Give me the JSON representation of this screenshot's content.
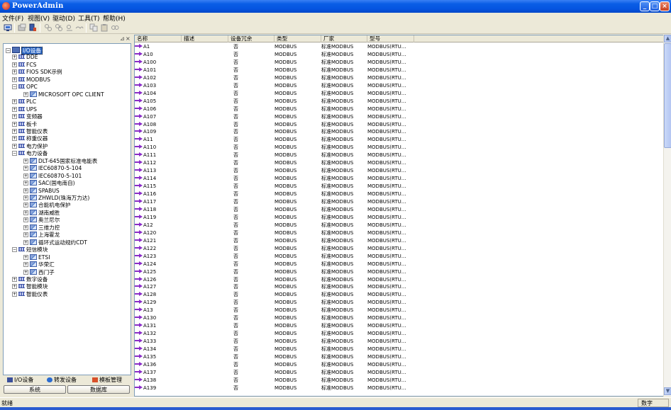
{
  "window": {
    "title": "PowerAdmin"
  },
  "menu": [
    "文件(F)",
    "视图(V)",
    "驱动(D)",
    "工具(T)",
    "帮助(H)"
  ],
  "toolbar": {
    "icons": [
      "monitor-icon",
      "folder-add-icon",
      "device-add-icon",
      "tag-add-icon",
      "tag-copy-icon",
      "tag-paste-icon",
      "tag-link-icon",
      "copy-icon",
      "paste-icon",
      "find-icon"
    ]
  },
  "left_panel": {
    "pin_glyph": "⊿",
    "close_glyph": "×",
    "tree": [
      {
        "label": "I/O设备",
        "level": 0,
        "type": "root",
        "expand": "−",
        "selected": true
      },
      {
        "label": "DDE",
        "level": 1,
        "type": "folder",
        "expand": "+"
      },
      {
        "label": "FCS",
        "level": 1,
        "type": "folder",
        "expand": "+"
      },
      {
        "label": "FIOS SDK示例",
        "level": 1,
        "type": "folder",
        "expand": "+"
      },
      {
        "label": "MODBUS",
        "level": 1,
        "type": "folder",
        "expand": "+"
      },
      {
        "label": "OPC",
        "level": 1,
        "type": "folder",
        "expand": "−"
      },
      {
        "label": "MICROSOFT OPC CLIENT",
        "level": 2,
        "type": "device",
        "expand": "+"
      },
      {
        "label": "PLC",
        "level": 1,
        "type": "folder",
        "expand": "+"
      },
      {
        "label": "UPS",
        "level": 1,
        "type": "folder",
        "expand": "+"
      },
      {
        "label": "变频器",
        "level": 1,
        "type": "folder",
        "expand": "+"
      },
      {
        "label": "板卡",
        "level": 1,
        "type": "folder",
        "expand": "+"
      },
      {
        "label": "智能仪表",
        "level": 1,
        "type": "folder",
        "expand": "+"
      },
      {
        "label": "称重仪器",
        "level": 1,
        "type": "folder",
        "expand": "+"
      },
      {
        "label": "电力保护",
        "level": 1,
        "type": "folder",
        "expand": "+"
      },
      {
        "label": "电力设备",
        "level": 1,
        "type": "folder",
        "expand": "−"
      },
      {
        "label": "DLT-645国家标准电能表",
        "level": 2,
        "type": "device",
        "expand": "+"
      },
      {
        "label": "IEC60870-5-104",
        "level": 2,
        "type": "device",
        "expand": "+"
      },
      {
        "label": "IEC60870-5-101",
        "level": 2,
        "type": "device",
        "expand": "+"
      },
      {
        "label": "SAC(国电南自)",
        "level": 2,
        "type": "device",
        "expand": "+"
      },
      {
        "label": "SPABUS",
        "level": 2,
        "type": "device",
        "expand": "+"
      },
      {
        "label": "ZHWLD(珠海万力达)",
        "level": 2,
        "type": "device",
        "expand": "+"
      },
      {
        "label": "合能机电保护",
        "level": 2,
        "type": "device",
        "expand": "+"
      },
      {
        "label": "湖南威胜",
        "level": 2,
        "type": "device",
        "expand": "+"
      },
      {
        "label": "奥兰尼尔",
        "level": 2,
        "type": "device",
        "expand": "+"
      },
      {
        "label": "三维力控",
        "level": 2,
        "type": "device",
        "expand": "+"
      },
      {
        "label": "上海霍龙",
        "level": 2,
        "type": "device",
        "expand": "+"
      },
      {
        "label": "循环式运动规约CDT",
        "level": 2,
        "type": "device",
        "expand": "+"
      },
      {
        "label": "短信模块",
        "level": 1,
        "type": "folder",
        "expand": "−"
      },
      {
        "label": "ETSI",
        "level": 2,
        "type": "device",
        "expand": "+"
      },
      {
        "label": "华荣汇",
        "level": 2,
        "type": "device",
        "expand": "+"
      },
      {
        "label": "西门子",
        "level": 2,
        "type": "device",
        "expand": "+"
      },
      {
        "label": "数字设备",
        "level": 1,
        "type": "folder",
        "expand": "+"
      },
      {
        "label": "智能模块",
        "level": 1,
        "type": "folder",
        "expand": "+"
      },
      {
        "label": "智能仪表",
        "level": 1,
        "type": "folder",
        "expand": "+"
      }
    ],
    "tabs": [
      "I/O设备",
      "转发设备",
      "模板管理"
    ],
    "bottom_tabs": [
      "系统",
      "数据库"
    ]
  },
  "list": {
    "columns": [
      "名称",
      "描述",
      "设备冗余",
      "类型",
      "厂家",
      "型号"
    ],
    "rows": [
      [
        "A1",
        "",
        "否",
        "MODBUS",
        "标准MODBUS",
        "MODBUS(RTU..."
      ],
      [
        "A10",
        "",
        "否",
        "MODBUS",
        "标准MODBUS",
        "MODBUS(RTU..."
      ],
      [
        "A100",
        "",
        "否",
        "MODBUS",
        "标准MODBUS",
        "MODBUS(RTU..."
      ],
      [
        "A101",
        "",
        "否",
        "MODBUS",
        "标准MODBUS",
        "MODBUS(RTU..."
      ],
      [
        "A102",
        "",
        "否",
        "MODBUS",
        "标准MODBUS",
        "MODBUS(RTU..."
      ],
      [
        "A103",
        "",
        "否",
        "MODBUS",
        "标准MODBUS",
        "MODBUS(RTU..."
      ],
      [
        "A104",
        "",
        "否",
        "MODBUS",
        "标准MODBUS",
        "MODBUS(RTU..."
      ],
      [
        "A105",
        "",
        "否",
        "MODBUS",
        "标准MODBUS",
        "MODBUS(RTU..."
      ],
      [
        "A106",
        "",
        "否",
        "MODBUS",
        "标准MODBUS",
        "MODBUS(RTU..."
      ],
      [
        "A107",
        "",
        "否",
        "MODBUS",
        "标准MODBUS",
        "MODBUS(RTU..."
      ],
      [
        "A108",
        "",
        "否",
        "MODBUS",
        "标准MODBUS",
        "MODBUS(RTU..."
      ],
      [
        "A109",
        "",
        "否",
        "MODBUS",
        "标准MODBUS",
        "MODBUS(RTU..."
      ],
      [
        "A11",
        "",
        "否",
        "MODBUS",
        "标准MODBUS",
        "MODBUS(RTU..."
      ],
      [
        "A110",
        "",
        "否",
        "MODBUS",
        "标准MODBUS",
        "MODBUS(RTU..."
      ],
      [
        "A111",
        "",
        "否",
        "MODBUS",
        "标准MODBUS",
        "MODBUS(RTU..."
      ],
      [
        "A112",
        "",
        "否",
        "MODBUS",
        "标准MODBUS",
        "MODBUS(RTU..."
      ],
      [
        "A113",
        "",
        "否",
        "MODBUS",
        "标准MODBUS",
        "MODBUS(RTU..."
      ],
      [
        "A114",
        "",
        "否",
        "MODBUS",
        "标准MODBUS",
        "MODBUS(RTU..."
      ],
      [
        "A115",
        "",
        "否",
        "MODBUS",
        "标准MODBUS",
        "MODBUS(RTU..."
      ],
      [
        "A116",
        "",
        "否",
        "MODBUS",
        "标准MODBUS",
        "MODBUS(RTU..."
      ],
      [
        "A117",
        "",
        "否",
        "MODBUS",
        "标准MODBUS",
        "MODBUS(RTU..."
      ],
      [
        "A118",
        "",
        "否",
        "MODBUS",
        "标准MODBUS",
        "MODBUS(RTU..."
      ],
      [
        "A119",
        "",
        "否",
        "MODBUS",
        "标准MODBUS",
        "MODBUS(RTU..."
      ],
      [
        "A12",
        "",
        "否",
        "MODBUS",
        "标准MODBUS",
        "MODBUS(RTU..."
      ],
      [
        "A120",
        "",
        "否",
        "MODBUS",
        "标准MODBUS",
        "MODBUS(RTU..."
      ],
      [
        "A121",
        "",
        "否",
        "MODBUS",
        "标准MODBUS",
        "MODBUS(RTU..."
      ],
      [
        "A122",
        "",
        "否",
        "MODBUS",
        "标准MODBUS",
        "MODBUS(RTU..."
      ],
      [
        "A123",
        "",
        "否",
        "MODBUS",
        "标准MODBUS",
        "MODBUS(RTU..."
      ],
      [
        "A124",
        "",
        "否",
        "MODBUS",
        "标准MODBUS",
        "MODBUS(RTU..."
      ],
      [
        "A125",
        "",
        "否",
        "MODBUS",
        "标准MODBUS",
        "MODBUS(RTU..."
      ],
      [
        "A126",
        "",
        "否",
        "MODBUS",
        "标准MODBUS",
        "MODBUS(RTU..."
      ],
      [
        "A127",
        "",
        "否",
        "MODBUS",
        "标准MODBUS",
        "MODBUS(RTU..."
      ],
      [
        "A128",
        "",
        "否",
        "MODBUS",
        "标准MODBUS",
        "MODBUS(RTU..."
      ],
      [
        "A129",
        "",
        "否",
        "MODBUS",
        "标准MODBUS",
        "MODBUS(RTU..."
      ],
      [
        "A13",
        "",
        "否",
        "MODBUS",
        "标准MODBUS",
        "MODBUS(RTU..."
      ],
      [
        "A130",
        "",
        "否",
        "MODBUS",
        "标准MODBUS",
        "MODBUS(RTU..."
      ],
      [
        "A131",
        "",
        "否",
        "MODBUS",
        "标准MODBUS",
        "MODBUS(RTU..."
      ],
      [
        "A132",
        "",
        "否",
        "MODBUS",
        "标准MODBUS",
        "MODBUS(RTU..."
      ],
      [
        "A133",
        "",
        "否",
        "MODBUS",
        "标准MODBUS",
        "MODBUS(RTU..."
      ],
      [
        "A134",
        "",
        "否",
        "MODBUS",
        "标准MODBUS",
        "MODBUS(RTU..."
      ],
      [
        "A135",
        "",
        "否",
        "MODBUS",
        "标准MODBUS",
        "MODBUS(RTU..."
      ],
      [
        "A136",
        "",
        "否",
        "MODBUS",
        "标准MODBUS",
        "MODBUS(RTU..."
      ],
      [
        "A137",
        "",
        "否",
        "MODBUS",
        "标准MODBUS",
        "MODBUS(RTU..."
      ],
      [
        "A138",
        "",
        "否",
        "MODBUS",
        "标准MODBUS",
        "MODBUS(RTU..."
      ],
      [
        "A139",
        "",
        "否",
        "MODBUS",
        "标准MODBUS",
        "MODBUS(RTU..."
      ]
    ]
  },
  "statusbar": {
    "left": "就绪",
    "right": "数字"
  },
  "colors": {
    "titlebar": "#0554e0",
    "selection": "#316ac5",
    "arrow": "#8a2cc8"
  }
}
